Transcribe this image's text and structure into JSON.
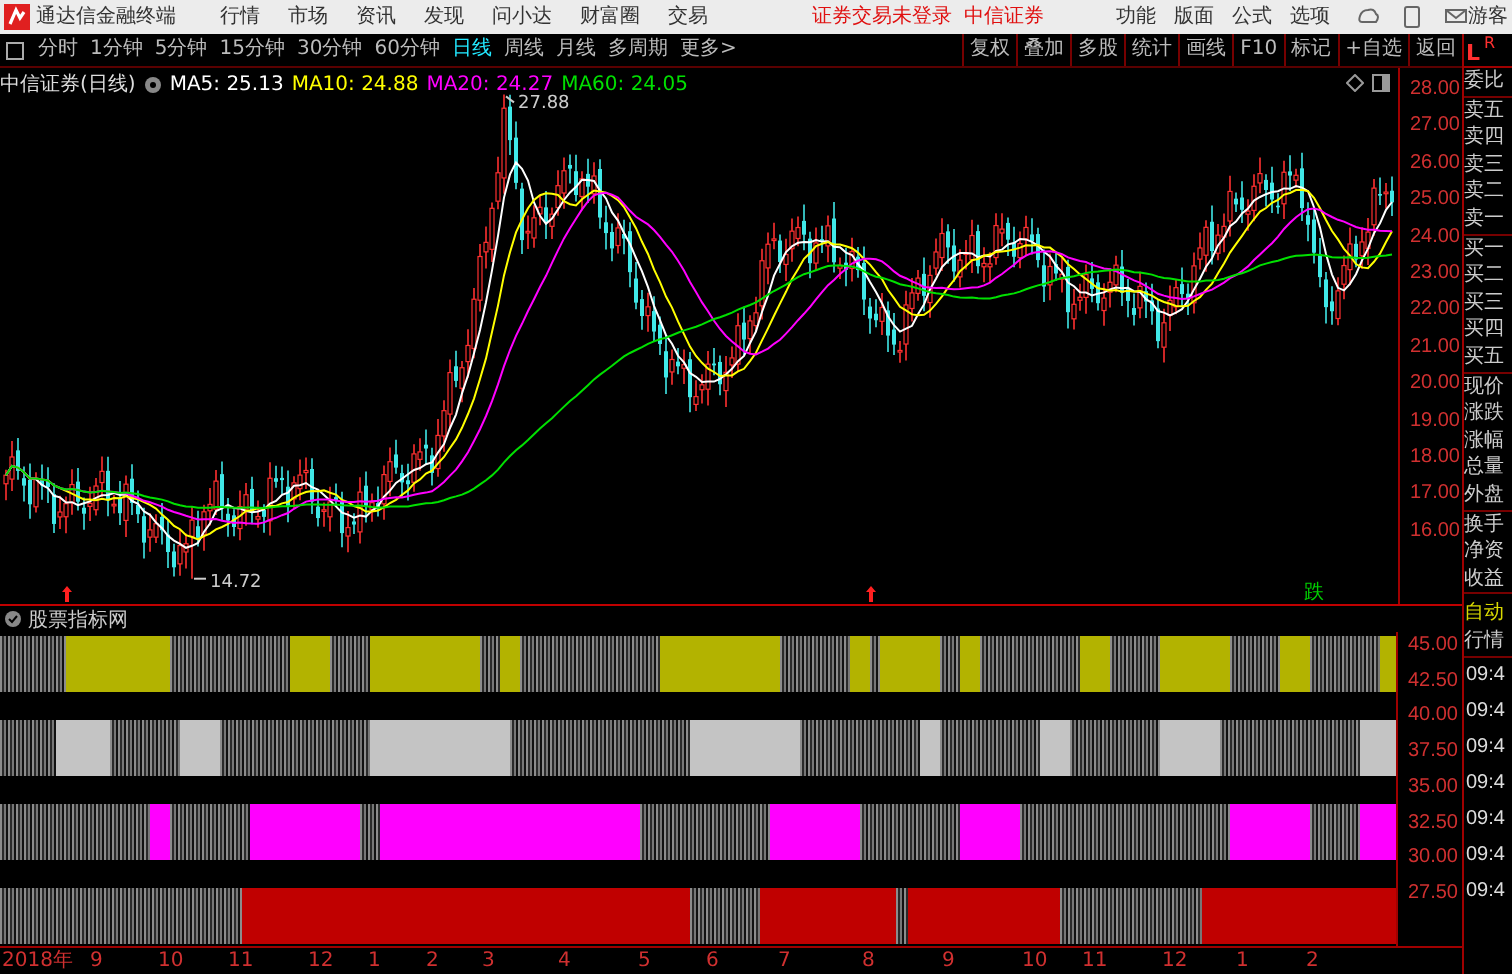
{
  "title_bar": {
    "app_name": "通达信金融终端",
    "menu": [
      "行情",
      "市场",
      "资讯",
      "发现",
      "问小达",
      "财富圈",
      "交易"
    ],
    "login_status": "证券交易未登录",
    "broker": "中信证券",
    "tools": [
      "功能",
      "版面",
      "公式",
      "选项"
    ],
    "user": "游客"
  },
  "period_tabs": [
    {
      "label": "分时",
      "selected": false
    },
    {
      "label": "1分钟",
      "selected": false
    },
    {
      "label": "5分钟",
      "selected": false
    },
    {
      "label": "15分钟",
      "selected": false
    },
    {
      "label": "30分钟",
      "selected": false
    },
    {
      "label": "60分钟",
      "selected": false
    },
    {
      "label": "日线",
      "selected": true
    },
    {
      "label": "周线",
      "selected": false
    },
    {
      "label": "月线",
      "selected": false
    },
    {
      "label": "多周期",
      "selected": false
    },
    {
      "label": "更多>",
      "selected": false
    }
  ],
  "chart_tools": [
    "复权",
    "叠加",
    "多股",
    "统计",
    "画线",
    "F10",
    "标记",
    "+自选",
    "返回"
  ],
  "chart": {
    "title": "中信证券(日线)",
    "moving_averages": [
      {
        "label": "MA5: 25.13",
        "color": "#ffffff"
      },
      {
        "label": "MA10: 24.88",
        "color": "#ffff00"
      },
      {
        "label": "MA20: 24.27",
        "color": "#ff00ff"
      },
      {
        "label": "MA60: 24.05",
        "color": "#00e000"
      }
    ],
    "high_marker": "27.88",
    "low_marker": "14.72",
    "signal_marks": [
      {
        "kind": "icon",
        "color": "#ff2020"
      },
      {
        "kind": "icon",
        "color": "#ff2020"
      },
      {
        "kind": "text",
        "label": "跌",
        "color": "#00d000"
      }
    ],
    "price_ticks": [
      "28.00",
      "27.00",
      "26.00",
      "25.00",
      "24.00",
      "23.00",
      "22.00",
      "21.00",
      "20.00",
      "19.00",
      "18.00",
      "17.00",
      "16.00"
    ]
  },
  "indicator": {
    "name": "股票指标网",
    "bands": [
      {
        "color": "#b3b300"
      },
      {
        "color": "#c4c4c4"
      },
      {
        "color": "#ff00ff"
      },
      {
        "color": "#c00000"
      }
    ],
    "ticks": [
      "45.00",
      "42.50",
      "40.00",
      "37.50",
      "35.00",
      "32.50",
      "30.00",
      "27.50"
    ]
  },
  "time_axis": [
    "2018年",
    "9",
    "10",
    "11",
    "12",
    "1",
    "2",
    "3",
    "4",
    "5",
    "6",
    "7",
    "8",
    "9",
    "10",
    "11",
    "12",
    "1",
    "2"
  ],
  "quote_panel": {
    "tabs": [
      "L",
      "R"
    ],
    "groups": [
      [
        "委比"
      ],
      [
        "卖五",
        "卖四",
        "卖三",
        "卖二",
        "卖一"
      ],
      [
        "买一",
        "买二",
        "买三",
        "买四",
        "买五"
      ],
      [
        "现价",
        "涨跌",
        "涨幅",
        "总量",
        "外盘"
      ],
      [
        "换手",
        "净资",
        "收益"
      ]
    ],
    "auto_label": "自动",
    "quotes_label": "行情",
    "times": [
      "09:4",
      "09:4",
      "09:4",
      "09:4",
      "09:4",
      "09:4",
      "09:4"
    ]
  }
}
